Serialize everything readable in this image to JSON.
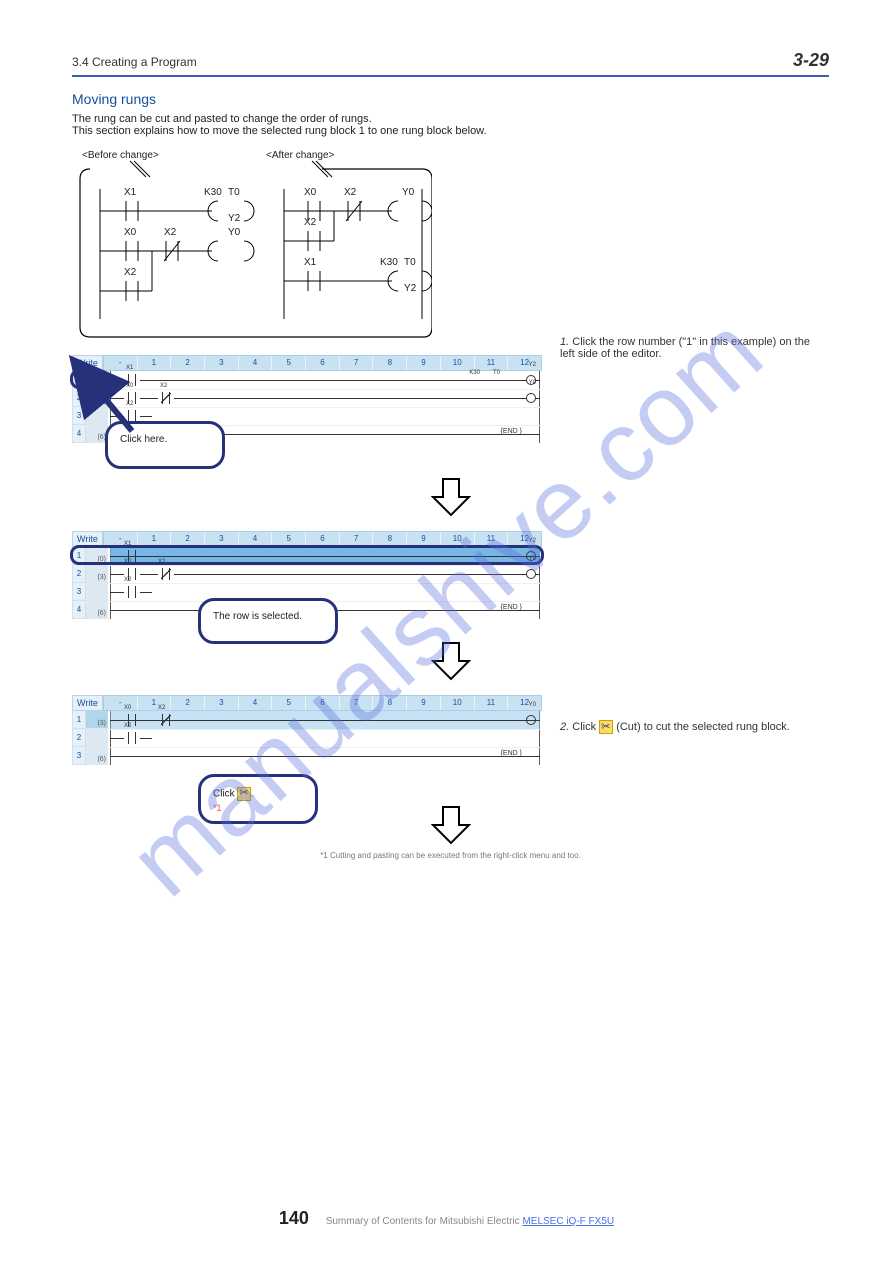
{
  "header": {
    "section": "3.4 Creating a Program",
    "pagenum": "3-29"
  },
  "heading": "Moving rungs",
  "intro": "The rung can be cut and pasted to change the order of rungs.\nThis section explains how to move the selected rung block 1 to one rung block below.",
  "schematic": {
    "before": "<Before change>",
    "after": "<After change>",
    "b_label_x1": "X1",
    "b_label_x0": "X0",
    "b_label_x2a": "X2",
    "b_label_x2b": "X2",
    "b_label_k30": "K30",
    "b_label_t0": "T0",
    "b_label_y2": "Y2",
    "b_label_y0": "Y0",
    "a_label_x0": "X0",
    "a_label_x2a": "X2",
    "a_label_x2b": "X2",
    "a_label_x1": "X1",
    "a_label_y0": "Y0",
    "a_label_k30": "K30",
    "a_label_t0": "T0",
    "a_label_y2": "Y2"
  },
  "ribbon": {
    "mode": "Write",
    "cols": [
      "-",
      "1",
      "2",
      "3",
      "4",
      "5",
      "6",
      "7",
      "8",
      "9",
      "10",
      "11",
      "12"
    ]
  },
  "panel1": {
    "rowcount": 4,
    "steps": [
      "(0)",
      "(3)",
      "",
      "(6)"
    ],
    "rung1": {
      "c": "X1",
      "out_out": "K30",
      "out_lab": "T0",
      "y": "Y2"
    },
    "rung2": {
      "c1": "X0",
      "c2": "X2",
      "y": "Y0"
    },
    "rung2b": {
      "c": "X2"
    },
    "end": "END"
  },
  "panel2": {
    "rowcount": 4,
    "steps": [
      "(0)",
      "(3)",
      "",
      "(6)"
    ],
    "rung1": {
      "c": "X1",
      "out_out": "K30",
      "out_lab": "T0",
      "y": "Y2"
    },
    "rung2": {
      "c1": "X0",
      "c2": "X2",
      "y": "Y0"
    },
    "rung2b": {
      "c": "X2"
    },
    "end": "END"
  },
  "panel3": {
    "rowcount": 3,
    "steps": [
      "(3)",
      "",
      "(6)"
    ],
    "rung2": {
      "c1": "X0",
      "c2": "X2",
      "y": "Y0"
    },
    "rung2b": {
      "c": "X2"
    },
    "end": "END"
  },
  "bubbles": {
    "b1": {
      "text": "Click here."
    },
    "b2": {
      "text": "The row is selected."
    },
    "b3": {
      "text": "Click",
      "note": "*1"
    }
  },
  "steps": {
    "s1": {
      "num": "1.",
      "text": "Click the row number (\"1\" in this example) on the left side of the editor."
    },
    "s2": {
      "num": "2.",
      "text_a": "Click ",
      "text_b": " (Cut) to cut the selected rung block."
    }
  },
  "footnote": "*1 Cutting and pasting can be executed from the right-click menu and    too.",
  "watermark": "manualshive.com",
  "footer": {
    "page": "140",
    "text_a": "Summary of Contents for Mitsubishi Electric ",
    "link": "MELSEC iQ-F FX5U"
  }
}
